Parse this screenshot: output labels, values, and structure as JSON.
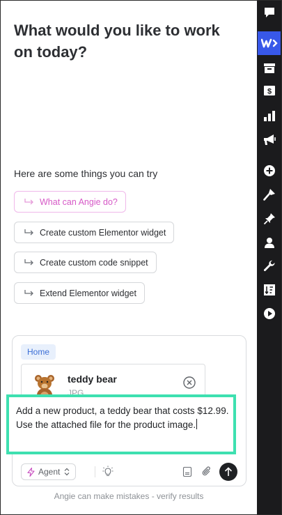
{
  "main": {
    "heading": "What would you like to work on today?",
    "try_label": "Here are some things you can try",
    "suggestions": [
      {
        "label": "What can Angie do?"
      },
      {
        "label": "Create custom Elementor widget"
      },
      {
        "label": "Create custom code snippet"
      },
      {
        "label": "Extend Elementor widget"
      }
    ]
  },
  "composer": {
    "context_badge": "Home",
    "attachment": {
      "name": "teddy bear",
      "type": "JPG"
    },
    "prompt": "Add a new product, a teddy bear that costs $12.99. Use the attached file for the product image.",
    "mode_label": "Agent"
  },
  "disclaimer": "Angie can make mistakes - verify results",
  "sidebar": {
    "icons": [
      "comment-icon",
      "woocommerce-icon",
      "archive-icon",
      "money-icon",
      "chart-icon",
      "megaphone-icon",
      "plus-circle-icon",
      "brush-icon",
      "pin-icon",
      "user-icon",
      "wrench-icon",
      "sort-icon",
      "play-icon"
    ]
  },
  "colors": {
    "accent_teal": "#3ee0b0",
    "highlight_pink": "#d659c7",
    "badge_blue": "#3c6fd6",
    "sidebar_bg": "#1b1b1d",
    "sidebar_active": "#3858e9"
  }
}
